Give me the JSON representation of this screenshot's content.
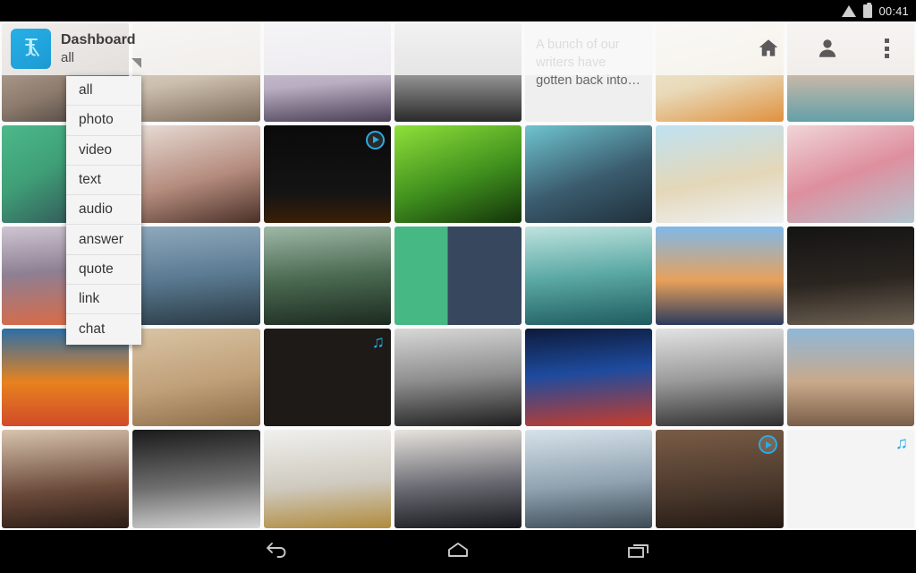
{
  "status_bar": {
    "time": "00:41",
    "wifi_icon": "wifi-icon",
    "battery_icon": "battery-icon"
  },
  "action_bar": {
    "logo_icon": "tumblr-logo-icon",
    "title": "Dashboard",
    "subtitle": "all",
    "spinner_icon": "dropdown-triangle-icon",
    "home_icon": "home-icon",
    "account_icon": "account-icon",
    "overflow_icon": "overflow-menu-icon",
    "accent_color": "#27b0e6"
  },
  "dropdown": {
    "open": true,
    "selected": "all",
    "items": [
      {
        "label": "all"
      },
      {
        "label": "photo"
      },
      {
        "label": "video"
      },
      {
        "label": "text"
      },
      {
        "label": "audio"
      },
      {
        "label": "answer"
      },
      {
        "label": "quote"
      },
      {
        "label": "link"
      },
      {
        "label": "chat"
      }
    ]
  },
  "grid": {
    "columns": 7,
    "badge_color": "#2aabe2",
    "rows": [
      {
        "cells": [
          {
            "name": "post-photo",
            "type": "photo",
            "bg": "linear-gradient(160deg,#cdbcae,#8d7b6e 60%,#3c3631)"
          },
          {
            "name": "post-photo",
            "type": "photo",
            "bg": "linear-gradient(170deg,#e9e3da,#cdbfae 55%,#7b6a5a)"
          },
          {
            "name": "post-photo",
            "type": "photo",
            "bg": "linear-gradient(175deg,#dcd8e2,#b9aec2 60%,#4a3f55)"
          },
          {
            "name": "post-photo",
            "type": "photo",
            "bg": "linear-gradient(180deg,#cfcfcf,#8e8e8e 55%,#2a2a2a)"
          },
          {
            "name": "post-text",
            "type": "text",
            "text": "A bunch of our writers have gotten back into…",
            "bg": "#efefef"
          },
          {
            "name": "post-photo",
            "type": "photo",
            "bg": "linear-gradient(165deg,#f5f0e2,#e8d9b8 55%,#e0913f)"
          },
          {
            "name": "post-photo",
            "type": "photo",
            "bg": "linear-gradient(180deg,#e7ddd4,#cdb9a8 50%,#63a0a8)"
          }
        ]
      },
      {
        "cells": [
          {
            "name": "post-photo",
            "type": "photo",
            "bg": "linear-gradient(150deg,#4cb98a,#3f9f77 40%,#2f3b4d)"
          },
          {
            "name": "post-photo",
            "type": "photo",
            "bg": "linear-gradient(165deg,#e8ddd6,#b58c7e 55%,#4a3028)"
          },
          {
            "name": "post-video",
            "type": "video",
            "bg": "linear-gradient(180deg,#0a0a0a,#141414 70%,#3a1f06)"
          },
          {
            "name": "post-photo",
            "type": "photo",
            "bg": "linear-gradient(160deg,#8fe03a,#3f8f1e 55%,#14330a)"
          },
          {
            "name": "post-photo",
            "type": "photo",
            "bg": "linear-gradient(160deg,#6fc4cf,#3b5c6e 55%,#20303b)"
          },
          {
            "name": "post-photo",
            "type": "photo",
            "bg": "linear-gradient(170deg,#bfe2f2,#e4d7b8 55%,#eef1f3)"
          },
          {
            "name": "post-photo",
            "type": "photo",
            "bg": "linear-gradient(160deg,#f0d5d8,#de8f9e 50%,#b2c5cf)"
          }
        ]
      },
      {
        "cells": [
          {
            "name": "post-photo",
            "type": "photo",
            "bg": "linear-gradient(175deg,#cfc6d2,#8e7f93 45%,#e0693f)"
          },
          {
            "name": "post-photo",
            "type": "photo",
            "bg": "linear-gradient(175deg,#8fa9bd,#5b7b92 50%,#2a3a44)"
          },
          {
            "name": "post-photo",
            "type": "photo",
            "bg": "linear-gradient(175deg,#9fb8a8,#4c6b52 50%,#1c2a20)"
          },
          {
            "name": "post-photo",
            "type": "photo",
            "bg": "linear-gradient(90deg,#46b883 0%,#46b883 42%,#36475e 42%,#36475e 100%)"
          },
          {
            "name": "post-photo",
            "type": "photo",
            "bg": "linear-gradient(175deg,#bfe3de,#5aa8a4 50%,#1f5b5f)"
          },
          {
            "name": "post-photo",
            "type": "photo",
            "bg": "linear-gradient(180deg,#7fb9e8,#e8a05a 55%,#2b3a5c)"
          },
          {
            "name": "post-photo",
            "type": "photo",
            "bg": "linear-gradient(175deg,#141414,#2b2520 55%,#6d6052)"
          }
        ]
      },
      {
        "cells": [
          {
            "name": "post-photo",
            "type": "photo",
            "bg": "linear-gradient(180deg,#2b6fa8,#e8821e 55%,#d14a2a)"
          },
          {
            "name": "post-photo",
            "type": "photo",
            "bg": "linear-gradient(170deg,#d9c4a4,#c0a079 55%,#8a6c48)"
          },
          {
            "name": "post-audio",
            "type": "audio",
            "bg": "#1d1a17"
          },
          {
            "name": "post-photo",
            "type": "photo",
            "bg": "linear-gradient(175deg,#d8d8d8,#8e8e8e 50%,#1e1e1e)"
          },
          {
            "name": "post-photo",
            "type": "photo",
            "bg": "linear-gradient(175deg,#0d1a3a,#1e4b9e 45%,#c83c2a)"
          },
          {
            "name": "post-photo",
            "type": "photo",
            "bg": "linear-gradient(175deg,#e3e3e3,#9a9a9a 50%,#2e2e2e)"
          },
          {
            "name": "post-photo",
            "type": "photo",
            "bg": "linear-gradient(180deg,#8fb8d8,#c9a98a 55%,#7a5f49)"
          }
        ]
      },
      {
        "cells": [
          {
            "name": "post-photo",
            "type": "photo",
            "bg": "linear-gradient(175deg,#d8c4ae,#6b4a3a 60%,#2a1c16)"
          },
          {
            "name": "post-photo",
            "type": "photo",
            "bg": "linear-gradient(175deg,#1a1a1a,#6e6e6e 55%,#d6d6d6)"
          },
          {
            "name": "post-photo",
            "type": "photo",
            "bg": "linear-gradient(175deg,#f0f0ee,#cfcabf 55%,#b08a3a)"
          },
          {
            "name": "post-photo",
            "type": "photo",
            "bg": "linear-gradient(175deg,#e8e4de,#6a6a72 55%,#16161c)"
          },
          {
            "name": "post-photo",
            "type": "photo",
            "bg": "linear-gradient(175deg,#d6e2ea,#8fa2b0 55%,#3c4a55)"
          },
          {
            "name": "post-video",
            "type": "video",
            "bg": "linear-gradient(175deg,#7a5c46,#4a382c 60%,#241a14)"
          },
          {
            "name": "post-audio",
            "type": "audio",
            "bg": "#f4f4f4"
          }
        ]
      }
    ]
  },
  "nav_bar": {
    "back_icon": "back-icon",
    "home_icon": "home-icon",
    "recents_icon": "recents-icon"
  }
}
